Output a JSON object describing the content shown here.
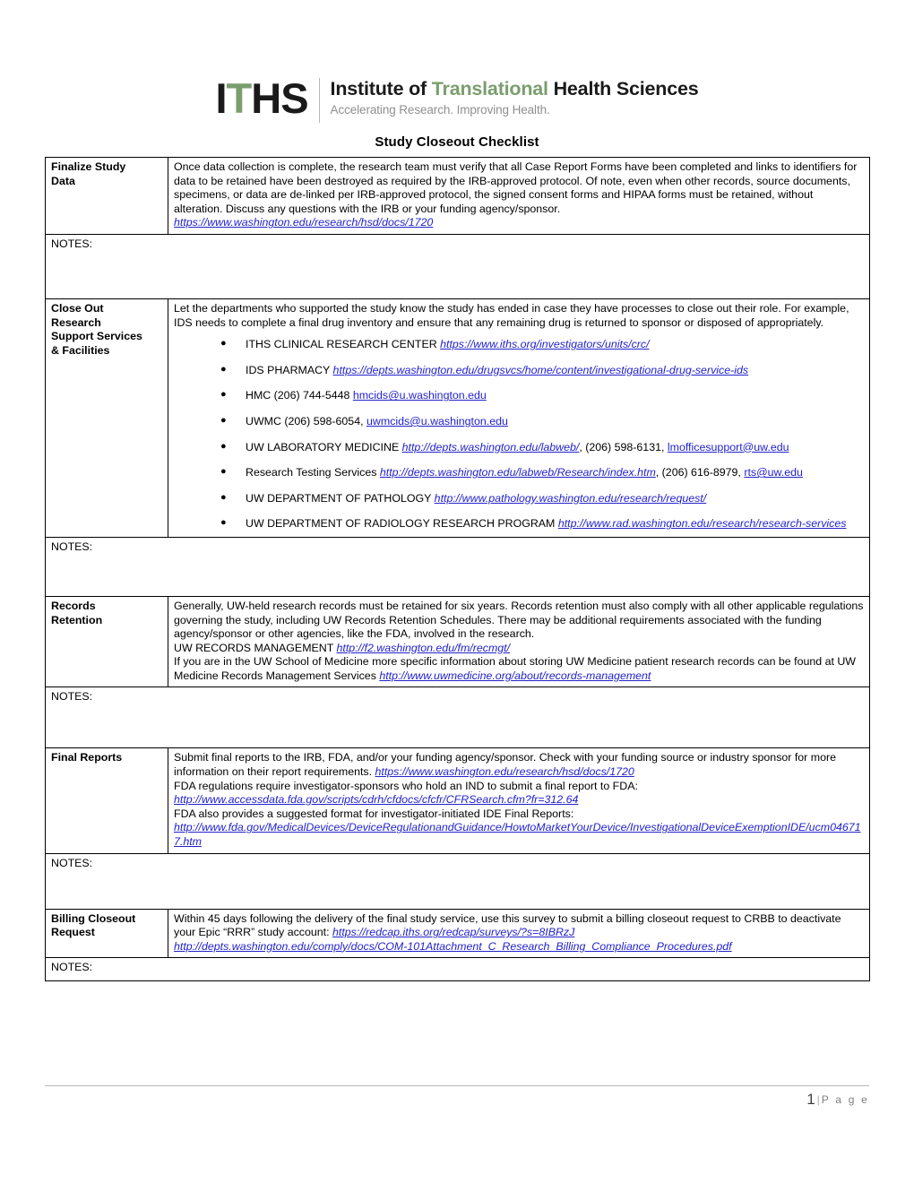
{
  "logo": {
    "mark_prefix": "I",
    "mark_accent": "T",
    "mark_suffix": "HS",
    "title_part1": "Institute of ",
    "title_accent": "Translational",
    "title_part2": " Health Sciences",
    "tagline": "Accelerating Research. Improving Health.",
    "accent_color": "#7a9e6e"
  },
  "document": {
    "title": "Study Closeout Checklist",
    "notes_label": "NOTES:",
    "link_color": "#2222cc"
  },
  "rows": [
    {
      "label_lines": [
        "Finalize Study",
        "Data"
      ],
      "paragraphs": [
        "Once data collection is complete, the research team must verify that all Case Report Forms have been completed and links to identifiers for data to be retained have been destroyed as required by the IRB-approved protocol.  Of note, even when other records, source documents, specimens, or data are de-linked per IRB-approved protocol, the signed consent forms and HIPAA forms must be retained, without alteration.  Discuss any questions with the IRB or your funding agency/sponsor."
      ],
      "link": "https://www.washington.edu/research/hsd/docs/1720"
    },
    {
      "label_lines": [
        "Close Out",
        "Research",
        "Support Services",
        "& Facilities"
      ],
      "paragraphs": [
        "Let the departments who supported the study know the study has ended in case they have processes to close out their role.  For example, IDS needs to complete a final drug inventory and ensure that any remaining drug is returned to sponsor or disposed of appropriately."
      ],
      "bullets": [
        {
          "text": "ITHS CLINICAL RESEARCH CENTER ",
          "link": "https://www.iths.org/investigators/units/crc/"
        },
        {
          "text": "IDS PHARMACY ",
          "link": "https://depts.washington.edu/drugsvcs/home/content/investigational-drug-service-ids"
        },
        {
          "text": "HMC (206) 744-5448 ",
          "email": "hmcids@u.washington.edu"
        },
        {
          "text": "UWMC (206) 598-6054, ",
          "email": "uwmcids@u.washington.edu"
        },
        {
          "text": "UW LABORATORY MEDICINE ",
          "link": "http://depts.washington.edu/labweb/",
          "tail": ", (206) 598-6131, ",
          "email": "lmofficesupport@uw.edu"
        },
        {
          "text": "Research Testing Services ",
          "link": "http://depts.washington.edu/labweb/Research/index.htm",
          "tail": ", (206) 616-8979, ",
          "email": "rts@uw.edu"
        },
        {
          "text": "UW DEPARTMENT OF PATHOLOGY ",
          "link": "http://www.pathology.washington.edu/research/request/"
        },
        {
          "text": "UW DEPARTMENT OF RADIOLOGY RESEARCH PROGRAM ",
          "link": "http://www.rad.washington.edu/research/research-services"
        }
      ]
    },
    {
      "label_lines": [
        "Records",
        "Retention"
      ],
      "paragraphs": [
        "Generally, UW-held research records must be retained for six years.  Records retention must also comply with all other applicable regulations governing the study, including UW Records Retention Schedules. There may be additional requirements associated with the funding agency/sponsor or other agencies, like the FDA, involved in the research."
      ],
      "line_label_1": "UW RECORDS MANAGEMENT ",
      "line_link_1": "http://f2.washington.edu/fm/recmgt/",
      "line_label_2": "If you are in the UW School of Medicine more specific information about storing UW Medicine patient research records can be found at UW Medicine Records Management Services ",
      "line_link_2": "http://www.uwmedicine.org/about/records-management"
    },
    {
      "label_lines": [
        "Final Reports"
      ],
      "lead_text": "Submit final reports to the IRB, FDA, and/or your funding agency/sponsor.  Check with your funding source or industry sponsor for more information on their report requirements. ",
      "lead_link": "https://www.washington.edu/research/hsd/docs/1720",
      "line2_text": "FDA regulations require investigator-sponsors who hold an IND to submit a final report to FDA:",
      "line2_link": "http://www.accessdata.fda.gov/scripts/cdrh/cfdocs/cfcfr/CFRSearch.cfm?fr=312.64",
      "line3_text": "FDA also provides a suggested format for investigator-initiated IDE Final Reports:",
      "line3_link": "http://www.fda.gov/MedicalDevices/DeviceRegulationandGuidance/HowtoMarketYourDevice/InvestigationalDeviceExemptionIDE/ucm046717.htm"
    },
    {
      "label_lines": [
        "Billing Closeout",
        "Request"
      ],
      "lead_text": "Within 45 days following the delivery of the final study service, use this survey to submit a billing closeout request to CRBB to deactivate your Epic “RRR” study account:  ",
      "lead_link": "https://redcap.iths.org/redcap/surveys/?s=8IBRzJ",
      "line2_link": "http://depts.washington.edu/comply/docs/COM-101Attachment_C_Research_Billing_Compliance_Procedures.pdf"
    }
  ],
  "footer": {
    "page_number": "1",
    "separator": "|",
    "page_word": "P a g e"
  }
}
